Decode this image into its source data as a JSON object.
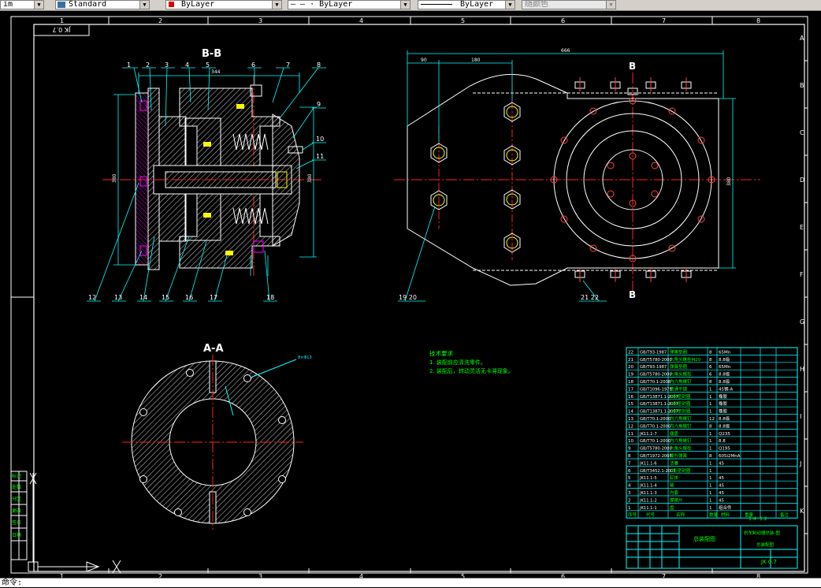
{
  "toolbar": {
    "combo1_value": "im",
    "textstyle_value": "Standard",
    "color_value": "ByLayer",
    "linetype_value": "— — · ByLayer",
    "lineweight_value": "ByLayer",
    "plotstyle_value": "随颜色",
    "colors": {
      "color_swatch": "#e00000"
    }
  },
  "drawing": {
    "drawing_code_top": "JK 0.7",
    "view_bb_label": "B-B",
    "view_aa_label": "A-A",
    "section_mark": "B",
    "callouts_top": [
      "1",
      "2",
      "3",
      "4",
      "5",
      "6",
      "7",
      "8"
    ],
    "callouts_right": [
      "9",
      "10",
      "11"
    ],
    "callouts_bottom": [
      "12",
      "13",
      "14",
      "15",
      "16",
      "17",
      "18"
    ],
    "callouts_front": [
      "19 20",
      "21 22"
    ],
    "dim_344": "344",
    "dim_666": "666",
    "dim_90": "90",
    "dim_180": "180",
    "dim_380": "380",
    "dim_side": "380",
    "aa_hole_label": "8×Φ13",
    "tech_req_title": "技术要求",
    "tech_req_1": "1. 装配前应清洗零件。",
    "tech_req_2": "2. 装配后，转动灵活无卡滞现象。",
    "border_cols": [
      "1",
      "2",
      "3",
      "4",
      "5",
      "6",
      "7",
      "8"
    ],
    "border_rows": [
      "A",
      "B",
      "C",
      "D",
      "E",
      "F",
      "G",
      "H",
      "I",
      "J",
      "K"
    ]
  },
  "bom": {
    "rows": [
      {
        "no": "22",
        "code": "GB/T93-1987",
        "name": "弹簧垫圈",
        "qty": "8",
        "mat": "65Mn"
      },
      {
        "no": "21",
        "code": "GB/T5780-2000",
        "name": "六角头螺栓M20",
        "qty": "8",
        "mat": "8.8级"
      },
      {
        "no": "20",
        "code": "GB/T93-1987",
        "name": "弹簧垫圈",
        "qty": "6",
        "mat": "65Mn"
      },
      {
        "no": "19",
        "code": "GB/T5780-2000",
        "name": "六角头螺栓",
        "qty": "6",
        "mat": "8.8级"
      },
      {
        "no": "18",
        "code": "GB/T70.1-2008",
        "name": "内六角螺钉",
        "qty": "8",
        "mat": "8.8级"
      },
      {
        "no": "17",
        "code": "GB/T1096-1979",
        "name": "普通平键",
        "qty": "1",
        "mat": "45钢-A"
      },
      {
        "no": "16",
        "code": "GB/T13871.1-2007",
        "name": "O形密封圈",
        "qty": "1",
        "mat": "橡胶"
      },
      {
        "no": "15",
        "code": "GB/T13871.1-2007",
        "name": "O形密封圈",
        "qty": "1",
        "mat": "橡胶"
      },
      {
        "no": "14",
        "code": "GB/T13871.1-2007",
        "name": "O形密封圈",
        "qty": "1",
        "mat": "橡胶"
      },
      {
        "no": "13",
        "code": "GB/T70.1-2000",
        "name": "内六角螺钉",
        "qty": "12",
        "mat": "8.8级"
      },
      {
        "no": "12",
        "code": "GB/T70.1-2000",
        "name": "内六角螺钉",
        "qty": "8",
        "mat": "8.8级"
      },
      {
        "no": "11",
        "code": "JK11.1-7",
        "name": "端盖",
        "qty": "1",
        "mat": "Q235"
      },
      {
        "no": "10",
        "code": "GB/T70.1-2000",
        "name": "内六角螺钉",
        "qty": "1",
        "mat": "8.8"
      },
      {
        "no": "9",
        "code": "GB/T5780-2000",
        "name": "六角头螺栓",
        "qty": "1",
        "mat": "Q195"
      },
      {
        "no": "8",
        "code": "GB/T1972-2005",
        "name": "碟形弹簧",
        "qty": "8",
        "mat": "60Si2MnA"
      },
      {
        "no": "7",
        "code": "JK11.1-6",
        "name": "活塞",
        "qty": "1",
        "mat": "45"
      },
      {
        "no": "6",
        "code": "GB/T3452.1-2005",
        "name": "O形密封圈",
        "qty": "1",
        "mat": ""
      },
      {
        "no": "5",
        "code": "JK11.1-5",
        "name": "缸体",
        "qty": "1",
        "mat": "45"
      },
      {
        "no": "4",
        "code": "JK11.1-4",
        "name": "轴",
        "qty": "1",
        "mat": "45"
      },
      {
        "no": "3",
        "code": "JK11.1-3",
        "name": "内套",
        "qty": "1",
        "mat": "45"
      },
      {
        "no": "2",
        "code": "JK11.1-2",
        "name": "摩擦片",
        "qty": "1",
        "mat": "45"
      },
      {
        "no": "1",
        "code": "JK11.1-1",
        "name": "盘",
        "qty": "1",
        "mat": "组合件"
      }
    ],
    "header": {
      "no": "序号",
      "code": "代号",
      "name": "名称",
      "qty": "数量",
      "mat": "材料",
      "weight": "重量",
      "note": "备注"
    },
    "title_block": {
      "drawing_name": "总装配图",
      "part_title": "刹车制动器总装-图",
      "sub_title": "总装配图",
      "scale": "1:4",
      "sheet": "1:2",
      "code": "JK 0.7"
    }
  },
  "left_panel": {
    "labels": [
      "标记",
      "处数",
      "分区",
      "更改",
      "签名",
      "日期",
      "设计",
      "审核",
      "工艺",
      "批准"
    ]
  },
  "ucs": {
    "y_label": "Y",
    "x_label": "X"
  },
  "status": {
    "command_text": "命令:"
  }
}
